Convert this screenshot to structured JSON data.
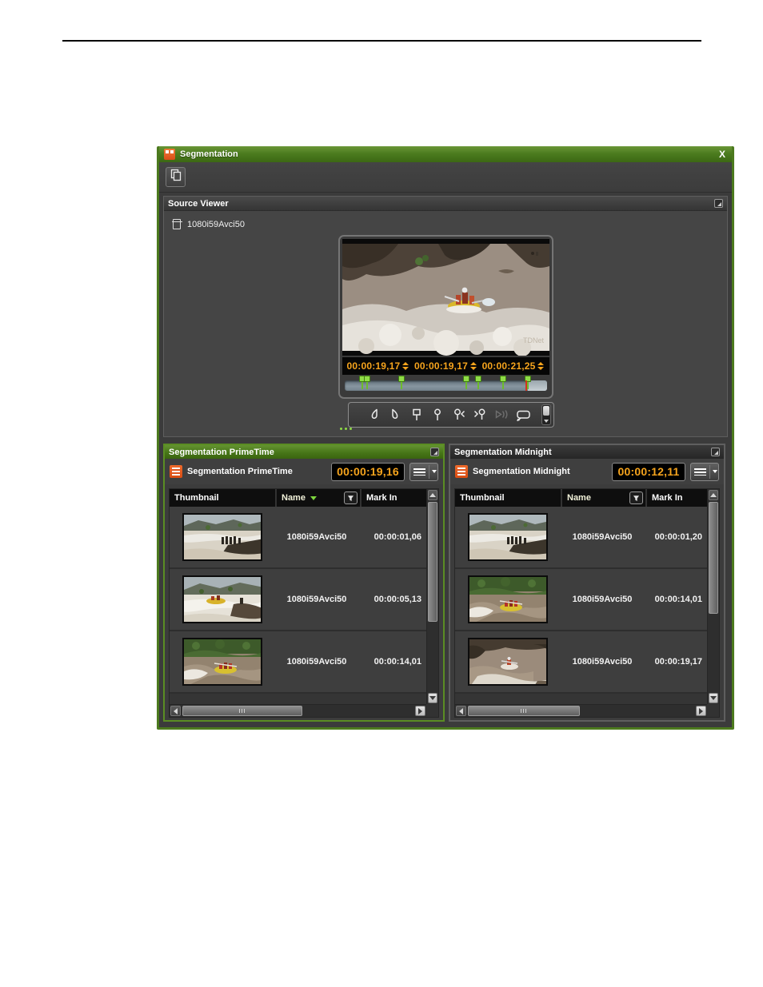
{
  "window": {
    "title": "Segmentation",
    "close_glyph": "X"
  },
  "toolbar": {
    "buttons": [
      {
        "name": "duplicate-button",
        "icon": "copy-icon"
      }
    ]
  },
  "source_viewer": {
    "title": "Source Viewer",
    "clip_name": "1080i59Avci50",
    "timecodes": {
      "mark_in": "00:00:19,17",
      "position": "00:00:19,17",
      "mark_out": "00:00:21,25"
    },
    "timeline": {
      "marker_positions_pct": [
        7.5,
        9.5,
        26.5,
        58.5,
        64.5,
        77,
        89
      ],
      "playhead_pct": 89.5
    },
    "player_tools": [
      "mark-in-icon",
      "mark-out-icon",
      "flag-marker-icon",
      "point-marker-icon",
      "previous-marker-icon",
      "next-marker-icon",
      "play-to-out-icon",
      "loop-icon"
    ]
  },
  "panels": [
    {
      "title": "Segmentation PrimeTime",
      "label": "Segmentation PrimeTime",
      "timecode": "00:00:19,16",
      "columns": [
        "Thumbnail",
        "Name",
        "Mark In"
      ],
      "name_sorted": "desc",
      "rows": [
        {
          "name": "1080i59Avci50",
          "mark_in": "00:00:01,06"
        },
        {
          "name": "1080i59Avci50",
          "mark_in": "00:00:05,13"
        },
        {
          "name": "1080i59Avci50",
          "mark_in": "00:00:14,01"
        }
      ]
    },
    {
      "title": "Segmentation Midnight",
      "label": "Segmentation Midnight",
      "timecode": "00:00:12,11",
      "columns": [
        "Thumbnail",
        "Name",
        "Mark In"
      ],
      "rows": [
        {
          "name": "1080i59Avci50",
          "mark_in": "00:00:01,20"
        },
        {
          "name": "1080i59Avci50",
          "mark_in": "00:00:14,01"
        },
        {
          "name": "1080i59Avci50",
          "mark_in": "00:00:19,17"
        }
      ]
    }
  ],
  "colors": {
    "window_green": "#4c7a1e",
    "accent_orange": "#e8581f",
    "timecode_orange": "#f6a41d",
    "marker_green": "#8fdc46"
  }
}
